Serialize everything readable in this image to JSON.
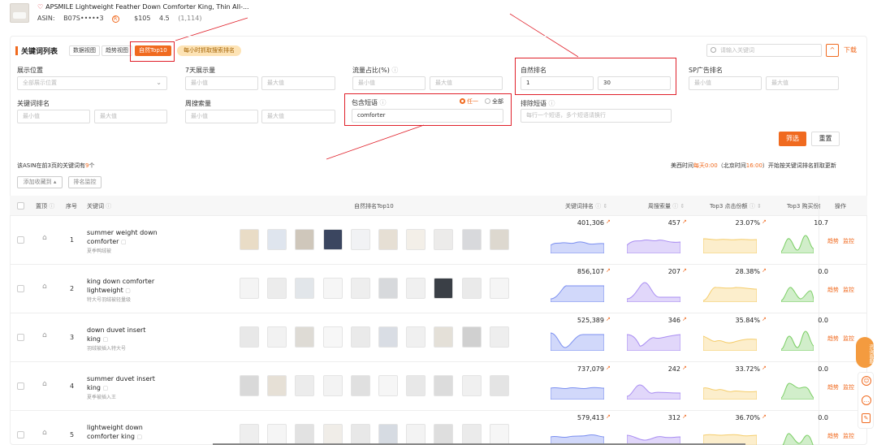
{
  "product": {
    "title": "APSMILE Lightweight Feather Down Comforter King, Thin All-...",
    "asin_label": "ASIN:",
    "asin": "B07S•••••3",
    "price": "$105",
    "rating": "4.5",
    "reviews": "(1,114)",
    "flag": "R"
  },
  "section": {
    "title": "关键词列表",
    "tabs": [
      "数据视图",
      "趋势视图",
      "自然Top10"
    ],
    "hourly_pill": "每小时抓取搜索排名",
    "search_placeholder": "请输入关键词",
    "collapse_icon": "^",
    "download": "下载"
  },
  "filters": {
    "placement": {
      "label": "展示位置",
      "placeholder": "全部展示位置"
    },
    "search_volume_7d": {
      "label": "7天展示量",
      "min": "最小值",
      "max": "最大值"
    },
    "traffic_share": {
      "label": "流量占比(%)",
      "min": "最小值",
      "max": "最大值"
    },
    "organic_rank": {
      "label": "自然排名",
      "min_value": "1",
      "max_value": "30"
    },
    "sp_ad_rank": {
      "label": "SP广告排名",
      "min": "最小值",
      "max": "最大值"
    },
    "keyword_rank": {
      "label": "关键词排名",
      "min": "最小值",
      "max": "最大值"
    },
    "weekly_search": {
      "label": "周搜索量",
      "min": "最小值",
      "max": "最大值"
    },
    "include_phrase": {
      "label": "包含短语",
      "value": "comforter",
      "opt_any": "任一",
      "opt_all": "全部"
    },
    "exclude_phrase": {
      "label": "排除短语",
      "placeholder": "每行一个短语，多个短语请换行"
    },
    "filter_btn": "筛选",
    "reset_btn": "重置"
  },
  "summary": {
    "prefix": "该ASIN在前3页的关键词有",
    "count": "9",
    "suffix": "个",
    "add_collection": "添加收藏到 ▴",
    "rank_monitor": "排名监控",
    "tz_prefix": "美西时间",
    "tz_time": "每天0:00",
    "tz_mid": "（北京时间",
    "tz_bj": "16:00",
    "tz_suffix": "）开始按关键词排名抓取更新"
  },
  "table": {
    "headers": {
      "pin": "置顶",
      "index": "序号",
      "keyword": "关键词",
      "top10": "自然排名Top10",
      "kw_rank": "关键词排名",
      "weekly": "周搜索量",
      "click_share": "Top3 点击份额",
      "buy_share": "Top3 购买份额",
      "ops": "操作"
    },
    "rows": [
      {
        "idx": "1",
        "kw1": "summer weight down",
        "kw2": "comforter",
        "sub": "夏季鸭绒被",
        "rank": "401,306",
        "weekly": "457",
        "click": "23.07%",
        "buy": "10.7",
        "op1": "趋势",
        "op2": "监控"
      },
      {
        "idx": "2",
        "kw1": "king down comforter",
        "kw2": "lightweight",
        "sub": "特大号羽绒被轻量级",
        "rank": "856,107",
        "weekly": "207",
        "click": "28.38%",
        "buy": "0.0",
        "op1": "趋势",
        "op2": "监控"
      },
      {
        "idx": "3",
        "kw1": "down duvet insert",
        "kw2": "king",
        "sub": "羽绒被插入特大号",
        "rank": "525,389",
        "weekly": "346",
        "click": "35.84%",
        "buy": "0.0",
        "op1": "趋势",
        "op2": "监控"
      },
      {
        "idx": "4",
        "kw1": "summer duvet insert",
        "kw2": "king",
        "sub": "夏季被插入王",
        "rank": "737,079",
        "weekly": "242",
        "click": "33.72%",
        "buy": "0.0",
        "op1": "趋势",
        "op2": "监控"
      },
      {
        "idx": "5",
        "kw1": "lightweight down",
        "kw2": "comforter king",
        "sub": "",
        "rank": "579,413",
        "weekly": "312",
        "click": "36.70%",
        "buy": "0.0",
        "op1": "趋势",
        "op2": "监控"
      }
    ]
  },
  "float": {
    "consult": "咨询客服"
  },
  "colors": {
    "accent": "#f06a1f",
    "blue": "#7b8ff0",
    "purple": "#a98df2",
    "yellow": "#f5cd6c",
    "green": "#7ccf66",
    "red_box": "#e0202a"
  }
}
